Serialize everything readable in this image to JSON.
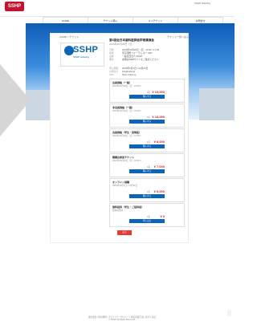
{
  "header": {
    "logo_text": "SSHP",
    "topright": "SSHP ticketing"
  },
  "nav": {
    "items": [
      {
        "label": "HOME"
      },
      {
        "label": "チケット購入"
      },
      {
        "label": "マイチケット"
      },
      {
        "label": "お問合せ"
      }
    ]
  },
  "card": {
    "breadcrumb_left": "HOME > チケット",
    "breadcrumb_right": "チケット一覧へ戻る",
    "brand": {
      "logo_text": "SSHP",
      "sub_text": "SSHP ticketing"
    },
    "event_title": "第6回全日本歯科医師会学術講演会",
    "event_subtitle": "2023年10月29日（日）",
    "info_rows": [
      {
        "key": "日時",
        "value": "2023年10月29日（日）10:00〜17:00"
      },
      {
        "key": "会場",
        "value": "東京国際フォーラム ホールB7"
      },
      {
        "key": "主催",
        "value": "一般社団法人 SSHP"
      },
      {
        "key": "備考",
        "value": "詳細はWEBサイトをご確認ください"
      }
    ],
    "info2_rows": [
      {
        "key": "申込期間",
        "value": "2023年9月1日〜10月25日"
      },
      {
        "key": "お問合せ",
        "value": "info@sshp.jp"
      },
      {
        "key": "URL",
        "value": "https://sshp.jp"
      }
    ],
    "tickets": [
      {
        "title": "会員価格（一般）",
        "subtitle": "2023年10月29日（日）10:00〜",
        "price_label": "1名",
        "price": "¥ 15,000",
        "button": "購入する"
      },
      {
        "title": "非会員価格（一般）",
        "subtitle": "2023年10月29日（日）10:00〜",
        "price_label": "1名",
        "price": "¥ 18,000",
        "button": "購入する"
      },
      {
        "title": "会員価格（学生・研修医）",
        "subtitle": "2023年10月29日（日）10:00〜",
        "price_label": "1名",
        "price": "¥ 8,000",
        "button": "購入する"
      },
      {
        "title": "懇親会参加チケット",
        "subtitle": "2023年10月29日（日）18:00〜",
        "price_label": "1名",
        "price": "¥ 7,000",
        "button": "購入する"
      },
      {
        "title": "オンライン視聴",
        "subtitle": "2023年11月1日〜11月30日",
        "price_label": "1名",
        "price": "¥ 5,000",
        "button": "購入する"
      },
      {
        "title": "無料招待（学生・ご招待者）",
        "subtitle": "要事前登録",
        "price_label": "1名",
        "price": "¥ 0",
        "button": "申し込む"
      }
    ],
    "back_button": "戻る"
  },
  "footer": {
    "text": "運営会社 | 利用規約 | プライバシーポリシー | 特定商取引法に基づく表記",
    "copyright": "© SSHP All Rights Reserved."
  },
  "colors": {
    "primary": "#0b64b8",
    "danger": "#e53935",
    "price": "#c62828",
    "nav_indicator": "#009966"
  }
}
